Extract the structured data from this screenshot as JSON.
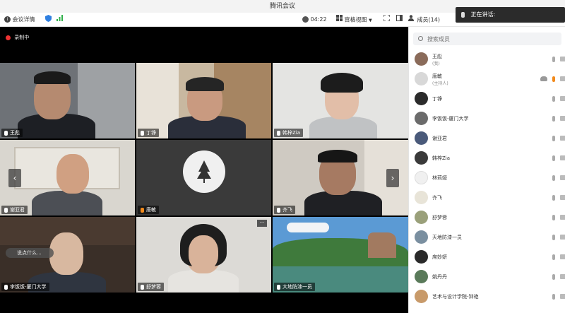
{
  "window": {
    "title": "腾讯会议"
  },
  "toolbar": {
    "meeting_details": "会议详情",
    "timer": "04:22",
    "view_mode": "宫格视图",
    "members": "成员(14)"
  },
  "speaking": {
    "label": "正在讲话:"
  },
  "video": {
    "recording_label": "录制中",
    "chat_hint": "说点什么...",
    "tiles": [
      {
        "name": "王彪"
      },
      {
        "name": "丁铮"
      },
      {
        "name": "韩梓Zia"
      },
      {
        "name": "谢亚君"
      },
      {
        "name": "唐敏"
      },
      {
        "name": "齐飞"
      },
      {
        "name": "李饭饭-厦门大学"
      },
      {
        "name": "舒梦蓉"
      },
      {
        "name": "大地防漆一员"
      }
    ]
  },
  "sidebar": {
    "search_placeholder": "搜索成员",
    "members": [
      {
        "name": "王彪",
        "role": "(我)",
        "avatar_color": "#8a6b5a"
      },
      {
        "name": "唐敏",
        "role": "(主持人)",
        "avatar_color": "#d8d8d8"
      },
      {
        "name": "丁铮",
        "role": "",
        "avatar_color": "#2b2b2b"
      },
      {
        "name": "李饭饭-厦门大学",
        "role": "",
        "avatar_color": "#6b6b6b"
      },
      {
        "name": "谢亚君",
        "role": "",
        "avatar_color": "#4a5a7a"
      },
      {
        "name": "韩梓Zia",
        "role": "",
        "avatar_color": "#3a3a3a"
      },
      {
        "name": "林莉娅",
        "role": "",
        "avatar_color": "#f0f0f0"
      },
      {
        "name": "齐飞",
        "role": "",
        "avatar_color": "#e8e4d8"
      },
      {
        "name": "舒梦蓉",
        "role": "",
        "avatar_color": "#9aa07a"
      },
      {
        "name": "天地防漆一员",
        "role": "",
        "avatar_color": "#7a8fa0"
      },
      {
        "name": "席妙妍",
        "role": "",
        "avatar_color": "#2a2a2a"
      },
      {
        "name": "姚丹丹",
        "role": "",
        "avatar_color": "#5a7a5a"
      },
      {
        "name": "艺术与设计学院-钟艳",
        "role": "",
        "avatar_color": "#c89a6a"
      }
    ]
  }
}
